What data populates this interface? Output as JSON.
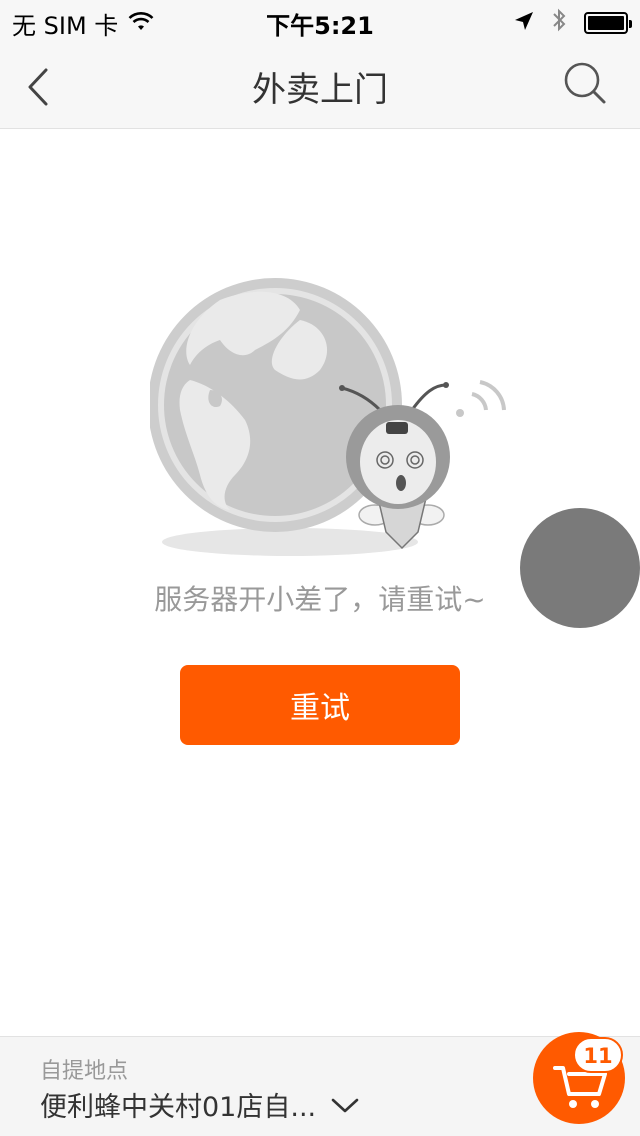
{
  "status_bar": {
    "carrier": "无 SIM 卡",
    "time": "下午5:21",
    "icons": [
      "wifi-icon",
      "location-arrow-icon",
      "bluetooth-icon",
      "battery-icon"
    ]
  },
  "nav": {
    "title": "外卖上门",
    "back_icon": "chevron-left-icon",
    "search_icon": "search-icon"
  },
  "error": {
    "message": "服务器开小差了，请重试~",
    "retry_label": "重试",
    "illustration": "globe-bee-mascot-illustration"
  },
  "bottom_bar": {
    "pickup_label": "自提地点",
    "store_name": "便利蜂中关村01店自...",
    "dropdown_icon": "chevron-down-icon",
    "cart_icon": "shopping-cart-icon",
    "cart_count": "11"
  },
  "colors": {
    "accent": "#ff5a00",
    "nav_bg": "#f7f7f7",
    "muted_text": "#999999",
    "float_circle": "#7a7a7a"
  }
}
